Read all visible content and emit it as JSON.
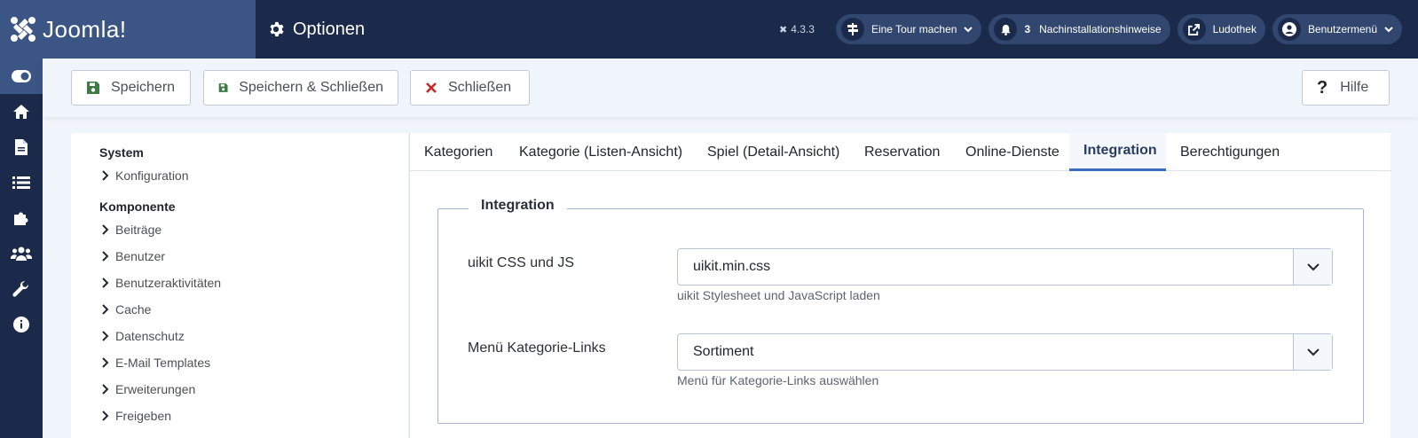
{
  "header": {
    "logo": "Joomla!",
    "title": "Optionen",
    "version": "4.3.3",
    "tour_label": "Eine Tour machen",
    "notifications_count": "3",
    "postinstall_label": "Nachinstallationshinweise",
    "site_label": "Ludothek",
    "user_menu_label": "Benutzermenü"
  },
  "sidebar": {
    "items": [
      "toggle-icon",
      "home-icon",
      "document-icon",
      "list-icon",
      "puzzle-icon",
      "users-icon",
      "wrench-icon",
      "info-icon"
    ]
  },
  "toolbar": {
    "save_label": "Speichern",
    "save_close_label": "Speichern & Schließen",
    "close_label": "Schließen",
    "help_label": "Hilfe"
  },
  "leftnav": {
    "group_system": "System",
    "system_items": [
      "Konfiguration"
    ],
    "group_component": "Komponente",
    "component_items": [
      "Beiträge",
      "Benutzer",
      "Benutzeraktivitäten",
      "Cache",
      "Datenschutz",
      "E-Mail Templates",
      "Erweiterungen",
      "Freigeben"
    ]
  },
  "tabs": [
    "Kategorien",
    "Kategorie (Listen-Ansicht)",
    "Spiel (Detail-Ansicht)",
    "Reservation",
    "Online-Dienste",
    "Integration",
    "Berechtigungen"
  ],
  "active_tab": "Integration",
  "integration": {
    "legend": "Integration",
    "fields": [
      {
        "label": "uikit CSS und JS",
        "value": "uikit.min.css",
        "hint": "uikit Stylesheet und JavaScript laden"
      },
      {
        "label": "Menü Kategorie-Links",
        "value": "Sortiment",
        "hint": "Menü für Kategorie-Links auswählen"
      }
    ]
  },
  "colors": {
    "header_bg": "#1b2a4b",
    "logo_bg": "#3b5585",
    "save_green": "#3d7a46",
    "close_red": "#c52827",
    "tab_active": "#3b6dc4"
  }
}
